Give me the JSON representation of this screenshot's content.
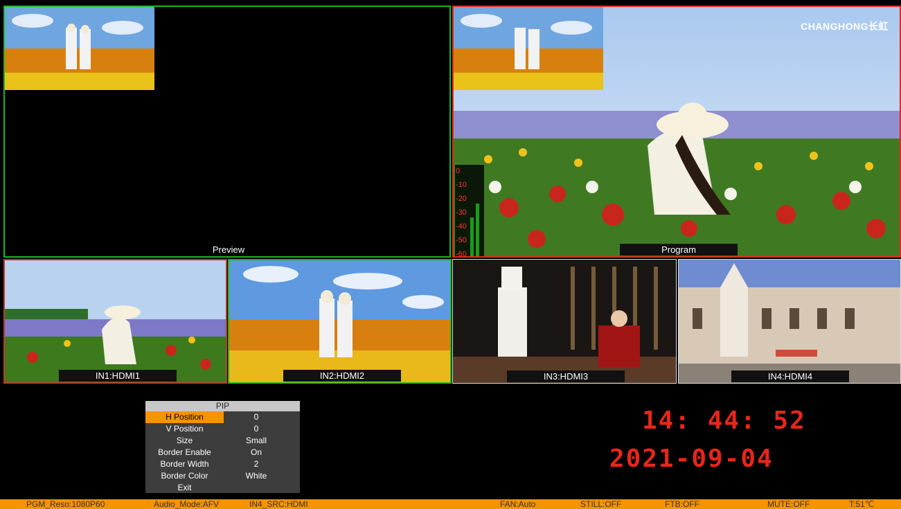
{
  "windows": {
    "preview": {
      "label": "Preview"
    },
    "program": {
      "label": "Program",
      "logo": "CHANGHONG长虹"
    },
    "in1": {
      "label": "IN1:HDMI1"
    },
    "in2": {
      "label": "IN2:HDMI2"
    },
    "in3": {
      "label": "IN3:HDMI3"
    },
    "in4": {
      "label": "IN4:HDMI4"
    }
  },
  "meter": {
    "ticks": [
      "0",
      "-10",
      "-20",
      "-30",
      "-40",
      "-50",
      "-60"
    ],
    "level_left": 0.45,
    "level_right": 0.6
  },
  "pip_menu": {
    "title": "PIP",
    "rows": [
      {
        "name": "H  Position",
        "value": "0",
        "selected": true
      },
      {
        "name": "V  Position",
        "value": "0"
      },
      {
        "name": "Size",
        "value": "Small"
      },
      {
        "name": "Border  Enable",
        "value": "On"
      },
      {
        "name": "Border  Width",
        "value": "2"
      },
      {
        "name": "Border  Color",
        "value": "White"
      },
      {
        "name": "Exit",
        "value": ""
      }
    ]
  },
  "clock": {
    "time": "14: 44: 52",
    "date": "2021-09-04"
  },
  "status_bar": {
    "pgm_reso": "PGM_Reso:1080P60",
    "audio_mode": "Audio_Mode:AFV",
    "in4_src": "IN4_SRC:HDMI",
    "fan": "FAN:Auto",
    "still": "STILL:OFF",
    "ftb": "FTB:OFF",
    "mute": "MUTE:OFF",
    "temp": "T:51℃"
  },
  "colors": {
    "preview_border": "#1bb81b",
    "program_border": "#e8261a",
    "status_bg": "#f39400",
    "clock": "#e8261a"
  }
}
